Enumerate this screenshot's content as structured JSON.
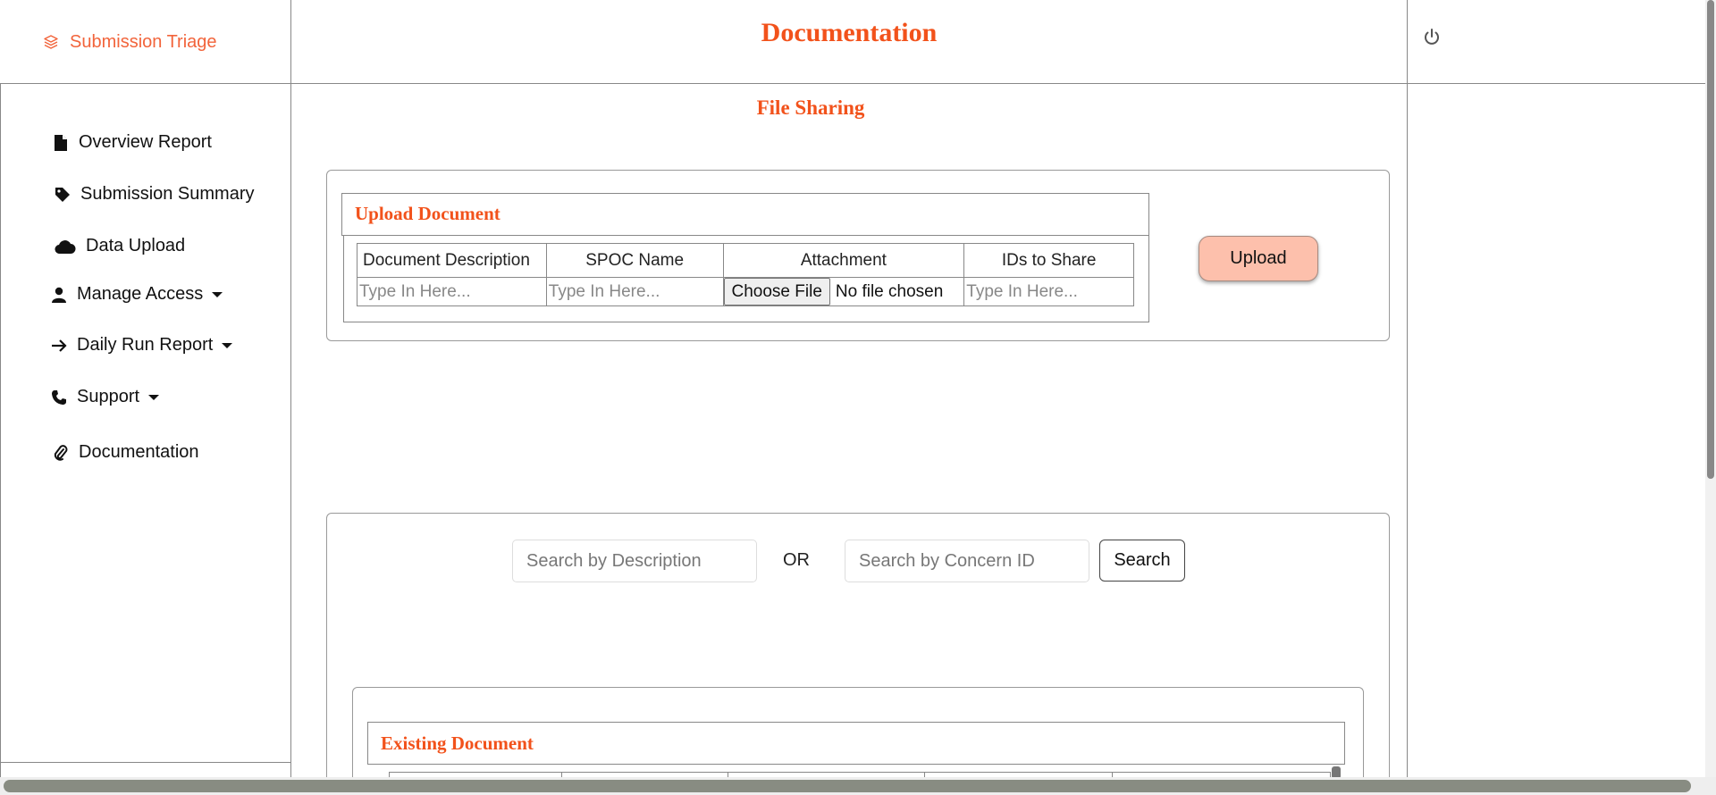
{
  "brand": {
    "label": "Submission Triage",
    "color": "#f2643b",
    "icon": "layers-icon"
  },
  "header": {
    "title": "Documentation",
    "title_color": "#f2521b",
    "power_icon": "power-icon"
  },
  "sidebar": {
    "items": [
      {
        "label": "Overview Report",
        "icon": "file-icon",
        "dropdown": false
      },
      {
        "label": "Submission Summary",
        "icon": "tag-icon",
        "dropdown": false
      },
      {
        "label": "Data Upload",
        "icon": "cloud-icon",
        "dropdown": false
      },
      {
        "label": "Manage Access",
        "icon": "user-icon",
        "dropdown": true
      },
      {
        "label": "Daily Run Report",
        "icon": "arrow-right-icon",
        "dropdown": true
      },
      {
        "label": "Support",
        "icon": "phone-icon",
        "dropdown": true
      },
      {
        "label": "Documentation",
        "icon": "paperclip-icon",
        "dropdown": false
      }
    ]
  },
  "main": {
    "section_title": "File Sharing",
    "upload": {
      "header": "Upload Document",
      "columns": [
        "Document Description",
        "SPOC Name",
        "Attachment",
        "IDs to Share"
      ],
      "description_placeholder": "Type In Here...",
      "spoc_placeholder": "Type In Here...",
      "ids_placeholder": "Type In Here...",
      "choose_file_label": "Choose File",
      "no_file_text": "No file chosen",
      "upload_button": "Upload",
      "upload_button_color": "#fdc0ac"
    },
    "search": {
      "description_placeholder": "Search by Description",
      "or_text": "OR",
      "concern_placeholder": "Search by Concern ID",
      "search_button": "Search"
    },
    "existing": {
      "header": "Existing Document"
    }
  }
}
